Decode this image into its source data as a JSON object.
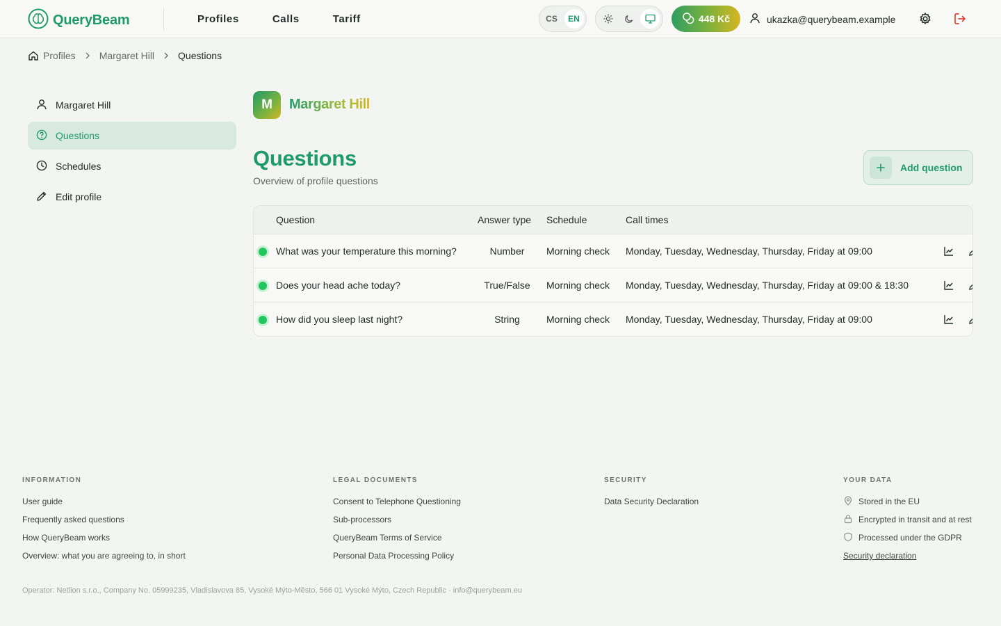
{
  "header": {
    "brand": "QueryBeam",
    "nav": [
      "Profiles",
      "Calls",
      "Tariff"
    ],
    "languages": [
      "CS",
      "EN"
    ],
    "active_language": "EN",
    "credit": "448 Kč",
    "user_email": "ukazka@querybeam.example"
  },
  "breadcrumb": [
    "Profiles",
    "Margaret Hill",
    "Questions"
  ],
  "sidebar": {
    "items": [
      {
        "label": "Margaret Hill",
        "icon": "user-icon"
      },
      {
        "label": "Questions",
        "icon": "question-circle-icon",
        "active": true
      },
      {
        "label": "Schedules",
        "icon": "clock-icon"
      },
      {
        "label": "Edit profile",
        "icon": "pencil-icon"
      }
    ]
  },
  "profile": {
    "initial": "M",
    "name": "Margaret Hill"
  },
  "page": {
    "title": "Questions",
    "subtitle": "Overview of profile questions",
    "add_button": "Add question"
  },
  "table": {
    "columns": [
      "Question",
      "Answer type",
      "Schedule",
      "Call times"
    ],
    "rows": [
      {
        "question": "What was your temperature this morning?",
        "answer_type": "Number",
        "schedule": "Morning check",
        "call_times": "Monday, Tuesday, Wednesday, Thursday, Friday at 09:00"
      },
      {
        "question": "Does your head ache today?",
        "answer_type": "True/False",
        "schedule": "Morning check",
        "call_times": "Monday, Tuesday, Wednesday, Thursday, Friday at 09:00 & 18:30"
      },
      {
        "question": "How did you sleep last night?",
        "answer_type": "String",
        "schedule": "Morning check",
        "call_times": "Monday, Tuesday, Wednesday, Thursday, Friday at 09:00"
      }
    ]
  },
  "footer": {
    "information": {
      "heading": "INFORMATION",
      "links": [
        "User guide",
        "Frequently asked questions",
        "How QueryBeam works",
        "Overview: what you are agreeing to, in short"
      ]
    },
    "legal": {
      "heading": "LEGAL DOCUMENTS",
      "links": [
        "Consent to Telephone Questioning",
        "Sub-processors",
        "QueryBeam Terms of Service",
        "Personal Data Processing Policy"
      ]
    },
    "security": {
      "heading": "SECURITY",
      "links": [
        "Data Security Declaration"
      ]
    },
    "your_data": {
      "heading": "YOUR DATA",
      "items": [
        "Stored in the EU",
        "Encrypted in transit and at rest",
        "Processed under the GDPR"
      ],
      "link": "Security declaration"
    },
    "operator": "Operator: Netlion s.r.o., Company No. 05999235, Vladislavova 85, Vysoké Mýto-Město, 566 01 Vysoké Mýto, Czech Republic · info@querybeam.eu"
  },
  "colors": {
    "brand": "#1f9a6a",
    "accent_gold": "#d6b522",
    "status_active": "#22c55e",
    "logout": "#e0413a"
  }
}
